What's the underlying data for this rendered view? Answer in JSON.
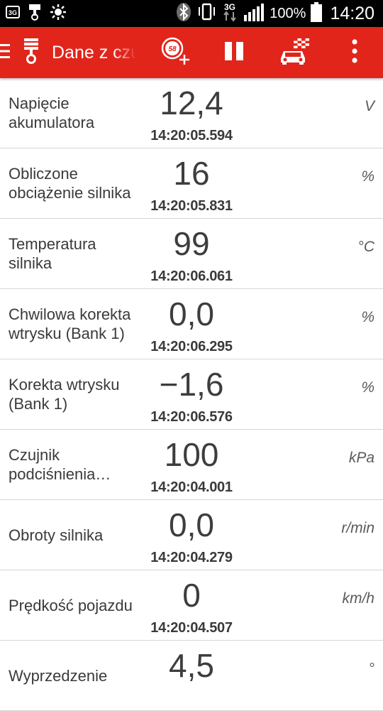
{
  "status_bar": {
    "network_type": "3G",
    "battery": "100%",
    "time": "14:20"
  },
  "app_bar": {
    "title": "Dane z czujników",
    "speed_badge": "58"
  },
  "rows": [
    {
      "label": "Napięcie akumulatora",
      "value": "12,4",
      "time": "14:20:05.594",
      "unit": "V"
    },
    {
      "label": "Obliczone obciążenie silnika",
      "value": "16",
      "time": "14:20:05.831",
      "unit": "%"
    },
    {
      "label": "Temperatura silnika",
      "value": "99",
      "time": "14:20:06.061",
      "unit": "°C"
    },
    {
      "label": "Chwilowa korekta wtrysku (Bank 1)",
      "value": "0,0",
      "time": "14:20:06.295",
      "unit": "%"
    },
    {
      "label": "Korekta wtrysku (Bank 1)",
      "value": "−1,6",
      "time": "14:20:06.576",
      "unit": "%"
    },
    {
      "label": "Czujnik podciśnienia…",
      "value": "100",
      "time": "14:20:04.001",
      "unit": "kPa"
    },
    {
      "label": "Obroty silnika",
      "value": "0,0",
      "time": "14:20:04.279",
      "unit": "r/min"
    },
    {
      "label": "Prędkość pojazdu",
      "value": "0",
      "time": "14:20:04.507",
      "unit": "km/h"
    },
    {
      "label": "Wyprzedzenie",
      "value": "4,5",
      "time": "",
      "unit": "°"
    }
  ],
  "icons": {
    "accent_color": "#e1251b"
  }
}
